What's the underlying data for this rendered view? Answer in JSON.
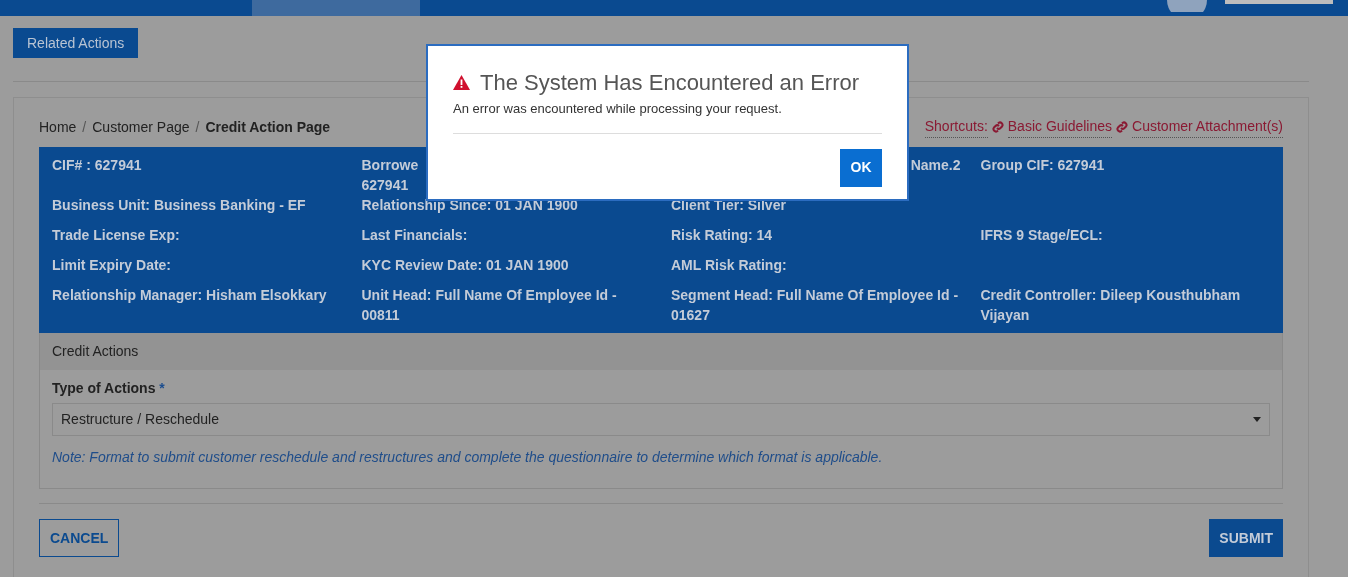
{
  "related_actions_tab": {
    "label": "Related Actions"
  },
  "breadcrumb_separator": "/",
  "breadcrumb": [
    {
      "label": "Home",
      "current": false
    },
    {
      "label": "Customer Page",
      "current": false
    },
    {
      "label": "Credit Action Page",
      "current": true
    }
  ],
  "shortcuts": {
    "label": "Shortcuts:",
    "links": [
      "Basic Guidelines",
      "Customer Attachment(s)"
    ]
  },
  "info_panel": {
    "rows": [
      [
        "CIF# : 627941",
        "Borrowe\n627941",
        "Name.2",
        "Group CIF: 627941"
      ],
      [
        "Business Unit: Business Banking - EF",
        "Relationship Since: 01 JAN 1900",
        "Client Tier: Silver",
        ""
      ],
      [
        "Trade License Exp:",
        "Last Financials:",
        "Risk Rating: 14",
        "IFRS 9 Stage/ECL:"
      ],
      [
        "Limit Expiry Date:",
        "KYC Review Date: 01 JAN 1900",
        "AML Risk Rating:",
        ""
      ],
      [
        "Relationship Manager: Hisham Elsokkary",
        "Unit Head: Full Name Of Employee Id - 00811",
        "Segment Head: Full Name Of Employee Id - 01627",
        "Credit Controller: Dileep Kousthubham Vijayan"
      ]
    ]
  },
  "credit_actions": {
    "title": "Credit Actions",
    "field_label": "Type of Actions",
    "required_mark": "*",
    "value": "Restructure / Reschedule",
    "note": "Note: Format to submit customer reschedule and restructures and complete the questionnaire to determine which format is applicable."
  },
  "buttons": {
    "cancel": "CANCEL",
    "submit": "SUBMIT"
  },
  "modal": {
    "title": "The System Has Encountered an Error",
    "message": "An error was encountered while processing your request.",
    "ok": "OK"
  }
}
